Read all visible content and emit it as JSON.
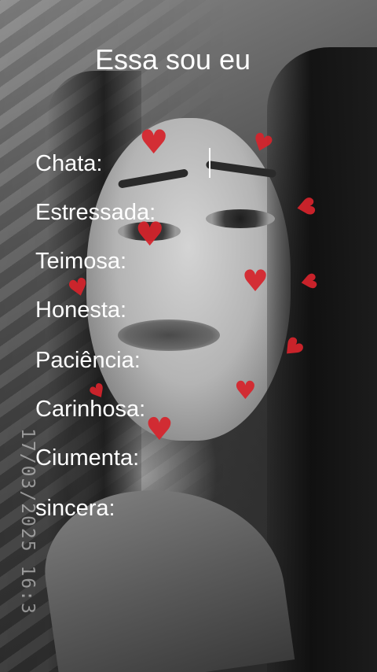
{
  "title": "Essa sou eu",
  "fields": [
    {
      "label": "Chata:"
    },
    {
      "label": "Estressada:"
    },
    {
      "label": "Teimosa:"
    },
    {
      "label": "Honesta:"
    },
    {
      "label": "Paciência:"
    },
    {
      "label": "Carinhosa:"
    },
    {
      "label": "Ciumenta:"
    },
    {
      "label": "sincera:"
    }
  ],
  "stamp": "17/03/2025 16:3",
  "colors": {
    "text": "#ffffff",
    "heart": "#d6242c"
  },
  "heart_icon": "heart-icon"
}
